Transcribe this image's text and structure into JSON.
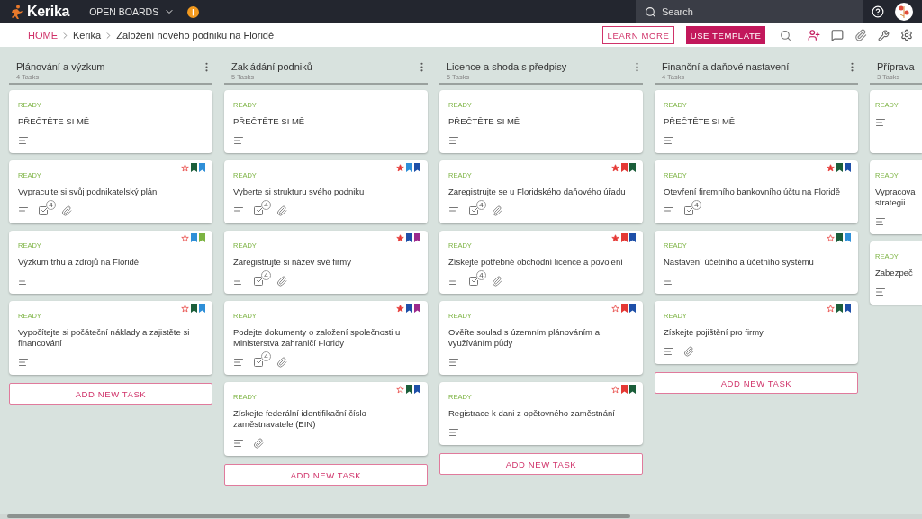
{
  "app": {
    "logo": "Kerika",
    "menu": "OPEN BOARDS",
    "search_placeholder": "Search"
  },
  "breadcrumb": [
    "HOME",
    "Kerika",
    "Založení nového podniku na Floridě"
  ],
  "actions": {
    "learn_more": "LEARN MORE",
    "use_template": "USE TEMPLATE"
  },
  "columns": [
    {
      "title": "Plánování a výzkum",
      "count": "4 Tasks",
      "add_label": "ADD NEW TASK",
      "cards": [
        {
          "kind": "readme",
          "status": "READY",
          "title": "PŘEČTĚTE SI MĚ"
        },
        {
          "kind": "task",
          "status": "READY",
          "title": "Vypracujte si svůj podnikatelský plán",
          "starred": false,
          "tags": [
            {
              "color": "#1b5e3a"
            },
            {
              "color": "#2f8fd8"
            }
          ],
          "checklist": "4",
          "attachment": true
        },
        {
          "kind": "task",
          "status": "READY",
          "title": "Výzkum trhu a zdrojů na Floridě",
          "starred": false,
          "tags": [
            {
              "color": "#2f8fd8"
            },
            {
              "color": "#7cb342"
            }
          ],
          "attachment": false
        },
        {
          "kind": "task",
          "status": "READY",
          "title": "Vypočítejte si počáteční náklady a zajistěte si financování",
          "starred": false,
          "tags": [
            {
              "color": "#1b5e3a"
            },
            {
              "color": "#2f8fd8"
            }
          ],
          "attachment": false
        }
      ]
    },
    {
      "title": "Zakládání podniků",
      "count": "5 Tasks",
      "add_label": "ADD NEW TASK",
      "cards": [
        {
          "kind": "readme",
          "status": "READY",
          "title": "PŘEČTĚTE SI MĚ"
        },
        {
          "kind": "task",
          "status": "READY",
          "title": "Vyberte si strukturu svého podniku",
          "starred": true,
          "tags": [
            {
              "color": "#2f8fd8"
            },
            {
              "color": "#1e4fa8"
            }
          ],
          "checklist": "4",
          "attachment": true
        },
        {
          "kind": "task",
          "status": "READY",
          "title": "Zaregistrujte si název své firmy",
          "starred": true,
          "tags": [
            {
              "color": "#1e4fa8"
            },
            {
              "color": "#9c2a8c"
            }
          ],
          "checklist": "4",
          "attachment": true
        },
        {
          "kind": "task",
          "status": "READY",
          "title": "Podejte dokumenty o založení společnosti u Ministerstva zahraničí Floridy",
          "starred": true,
          "tags": [
            {
              "color": "#1e4fa8"
            },
            {
              "color": "#9c2a8c"
            }
          ],
          "checklist": "4",
          "attachment": true
        },
        {
          "kind": "task",
          "status": "READY",
          "title": "Získejte federální identifikační číslo zaměstnavatele (EIN)",
          "starred": false,
          "tags": [
            {
              "color": "#1b5e3a"
            },
            {
              "color": "#1e4fa8"
            }
          ],
          "attachment": true
        }
      ]
    },
    {
      "title": "Licence a shoda s předpisy",
      "count": "5 Tasks",
      "add_label": "ADD NEW TASK",
      "cards": [
        {
          "kind": "readme",
          "status": "READY",
          "title": "PŘEČTĚTE SI MĚ"
        },
        {
          "kind": "task",
          "status": "READY",
          "title": "Zaregistrujte se u Floridského daňového úřadu",
          "starred": true,
          "tags": [
            {
              "color": "#e53935"
            },
            {
              "color": "#1b5e3a"
            }
          ],
          "checklist": "4",
          "attachment": true
        },
        {
          "kind": "task",
          "status": "READY",
          "title": "Získejte potřebné obchodní licence a povolení",
          "starred": true,
          "tags": [
            {
              "color": "#e53935"
            },
            {
              "color": "#1e4fa8"
            }
          ],
          "checklist": "4",
          "attachment": true
        },
        {
          "kind": "task",
          "status": "READY",
          "title": "Ověřte soulad s územním plánováním a využíváním půdy",
          "starred": false,
          "tags": [
            {
              "color": "#e53935"
            },
            {
              "color": "#1e4fa8"
            }
          ],
          "attachment": false
        },
        {
          "kind": "task",
          "status": "READY",
          "title": "Registrace k dani z opětovného zaměstnání",
          "starred": false,
          "tags": [
            {
              "color": "#e53935"
            },
            {
              "color": "#1b5e3a"
            }
          ],
          "attachment": false
        }
      ]
    },
    {
      "title": "Finanční a daňové nastavení",
      "count": "4 Tasks",
      "add_label": "ADD NEW TASK",
      "cards": [
        {
          "kind": "readme",
          "status": "READY",
          "title": "PŘEČTĚTE SI MĚ"
        },
        {
          "kind": "task",
          "status": "READY",
          "title": "Otevření firemního bankovního účtu na Floridě",
          "starred": true,
          "tags": [
            {
              "color": "#1b5e3a"
            },
            {
              "color": "#1e4fa8"
            }
          ],
          "checklist": "4",
          "attachment": false
        },
        {
          "kind": "task",
          "status": "READY",
          "title": "Nastavení účetního a účetního systému",
          "starred": false,
          "tags": [
            {
              "color": "#1b5e3a"
            },
            {
              "color": "#2f8fd8"
            }
          ],
          "attachment": false
        },
        {
          "kind": "task",
          "status": "READY",
          "title": "Získejte pojištění pro firmy",
          "starred": false,
          "tags": [
            {
              "color": "#1b5e3a"
            },
            {
              "color": "#1e4fa8"
            }
          ],
          "attachment": true
        }
      ]
    },
    {
      "title": "Příprava",
      "count": "3 Tasks",
      "cards": [
        {
          "kind": "readme",
          "status": "READY"
        },
        {
          "kind": "readme",
          "status": "READY",
          "title": "Vypracova strategii"
        },
        {
          "kind": "readme",
          "status": "READY",
          "title": "Zabezpeč"
        }
      ]
    }
  ]
}
